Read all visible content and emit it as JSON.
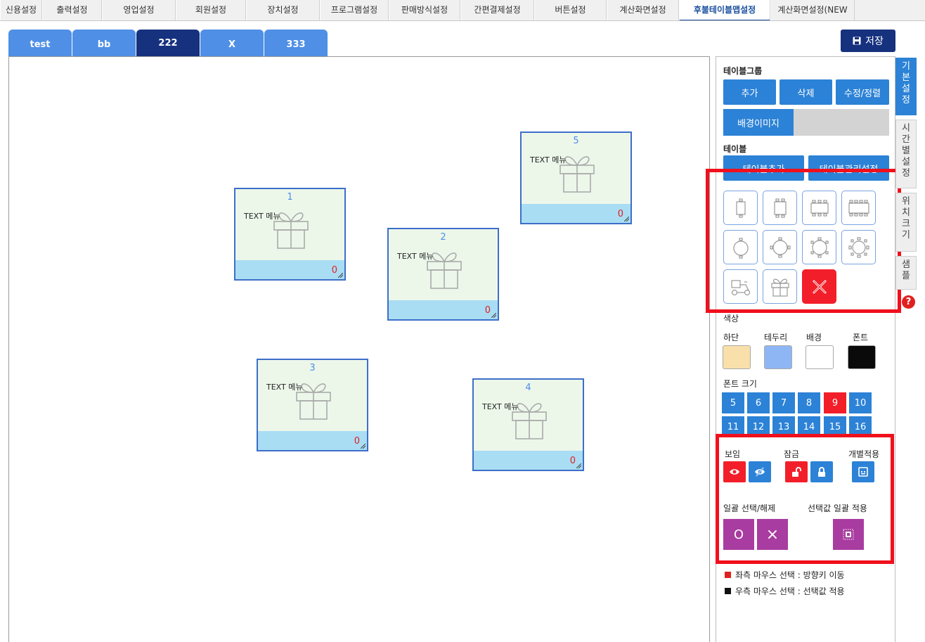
{
  "top_menu": [
    "신용설정",
    "출력설정",
    "영업설정",
    "회원설정",
    "장치설정",
    "프로그램설정",
    "판매방식설정",
    "간편결제설정",
    "버튼설정",
    "계산화면설정",
    "후불테이블맵설정",
    "계산화면설정(NEW"
  ],
  "top_menu_active": "후불테이블맵설정",
  "sub_tabs": [
    "test",
    "bb",
    "222",
    "X",
    "333"
  ],
  "sub_tab_active": "222",
  "save_label": "저장",
  "tables": [
    {
      "number": "1",
      "menu": "TEXT 메뉴",
      "count": "0"
    },
    {
      "number": "2",
      "menu": "TEXT 메뉴",
      "count": "0"
    },
    {
      "number": "3",
      "menu": "TEXT 메뉴",
      "count": "0"
    },
    {
      "number": "4",
      "menu": "TEXT 메뉴",
      "count": "0"
    },
    {
      "number": "5",
      "menu": "TEXT 메뉴",
      "count": "0"
    }
  ],
  "panel": {
    "table_group_label": "테이블그룹",
    "add_label": "추가",
    "delete_label": "삭제",
    "edit_sort_label": "수정/정렬",
    "bg_image_label": "배경이미지",
    "table_label": "테이블",
    "table_add_label": "테이블추가",
    "table_manage_label": "테이블관리설정",
    "shapes": [
      "table-1-seat-icon",
      "table-2-seat-icon",
      "table-6-seat-icon",
      "table-8-seat-icon",
      "round-2-seat-icon",
      "round-4-seat-icon",
      "round-6-seat-icon",
      "round-8-seat-icon",
      "delivery-scooter-icon",
      "gift-box-icon",
      "delete-x-icon"
    ],
    "color_label": "색상",
    "color_names": [
      "하단",
      "테두리",
      "배경",
      "폰트"
    ],
    "colors": [
      "#f9dfaa",
      "#8fb6f4",
      "#ffffff",
      "#0a0a0a"
    ],
    "font_size_label": "폰트 크기",
    "font_sizes": [
      "5",
      "6",
      "7",
      "8",
      "9",
      "10",
      "11",
      "12",
      "13",
      "14",
      "15",
      "16"
    ],
    "font_size_selected": "9",
    "visible_label": "보임",
    "lock_label": "잠금",
    "individual_label": "개별적용",
    "bulk_select_label": "일괄 선택/해제",
    "bulk_apply_label": "선택값 일괄 적용",
    "select_all_glyph": "O",
    "deselect_all_glyph": "×",
    "legend_left": "좌측 마우스 선택 : 방향키 이동",
    "legend_right": "우측 마우스 선택 : 선택값 적용"
  },
  "side_tabs": [
    "기본설정",
    "시간별설정",
    "위치크기",
    "샘플"
  ],
  "side_tab_active": "기본설정",
  "help_glyph": "?",
  "accent": "#2c82d6",
  "highlight": "#f0101c"
}
